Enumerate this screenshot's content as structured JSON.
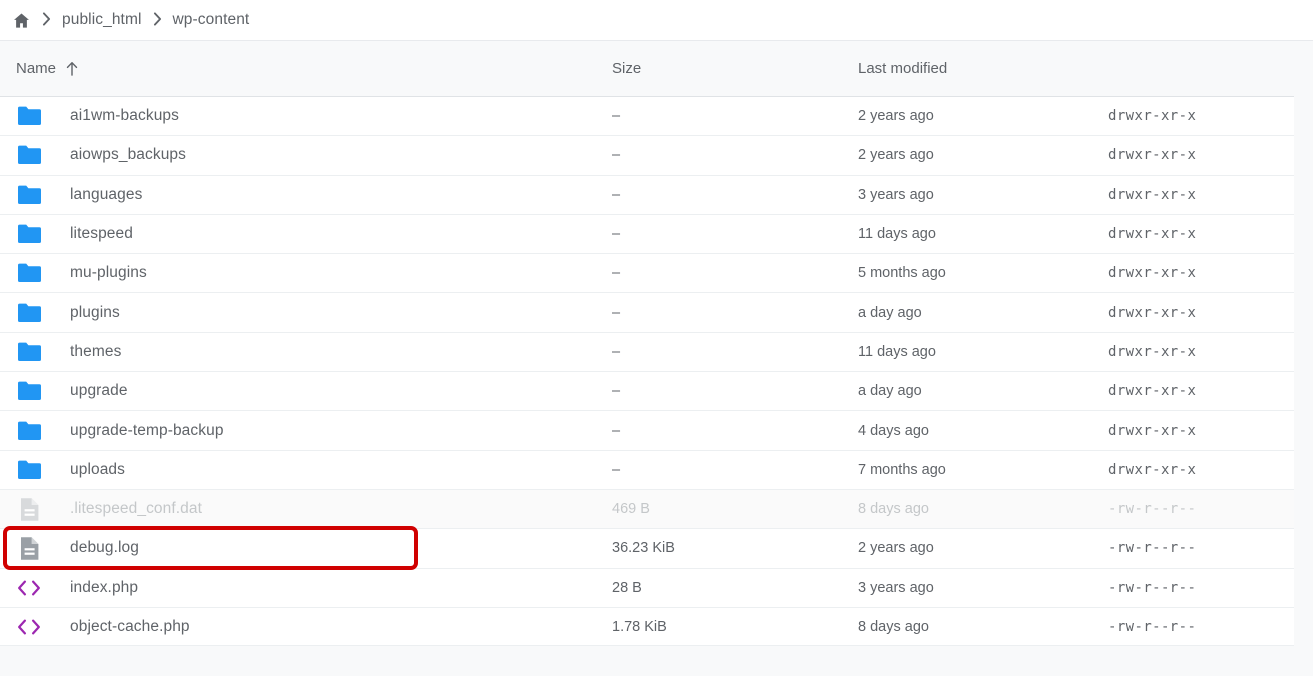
{
  "breadcrumb": {
    "home_icon": "home-icon",
    "separator": "›",
    "items": [
      {
        "label": "public_html"
      },
      {
        "label": "wp-content"
      }
    ]
  },
  "table": {
    "columns": {
      "name": "Name",
      "sort_indicator": "↑",
      "size": "Size",
      "modified": "Last modified",
      "permissions": ""
    },
    "rows": [
      {
        "icon": "folder-icon",
        "name": "ai1wm-backups",
        "size": "–",
        "modified": "2 years ago",
        "permissions": "drwxr-xr-x",
        "dimmed": false,
        "highlighted": false
      },
      {
        "icon": "folder-icon",
        "name": "aiowps_backups",
        "size": "–",
        "modified": "2 years ago",
        "permissions": "drwxr-xr-x",
        "dimmed": false,
        "highlighted": false
      },
      {
        "icon": "folder-icon",
        "name": "languages",
        "size": "–",
        "modified": "3 years ago",
        "permissions": "drwxr-xr-x",
        "dimmed": false,
        "highlighted": false
      },
      {
        "icon": "folder-icon",
        "name": "litespeed",
        "size": "–",
        "modified": "11 days ago",
        "permissions": "drwxr-xr-x",
        "dimmed": false,
        "highlighted": false
      },
      {
        "icon": "folder-icon",
        "name": "mu-plugins",
        "size": "–",
        "modified": "5 months ago",
        "permissions": "drwxr-xr-x",
        "dimmed": false,
        "highlighted": false
      },
      {
        "icon": "folder-icon",
        "name": "plugins",
        "size": "–",
        "modified": "a day ago",
        "permissions": "drwxr-xr-x",
        "dimmed": false,
        "highlighted": false
      },
      {
        "icon": "folder-icon",
        "name": "themes",
        "size": "–",
        "modified": "11 days ago",
        "permissions": "drwxr-xr-x",
        "dimmed": false,
        "highlighted": false
      },
      {
        "icon": "folder-icon",
        "name": "upgrade",
        "size": "–",
        "modified": "a day ago",
        "permissions": "drwxr-xr-x",
        "dimmed": false,
        "highlighted": false
      },
      {
        "icon": "folder-icon",
        "name": "upgrade-temp-backup",
        "size": "–",
        "modified": "4 days ago",
        "permissions": "drwxr-xr-x",
        "dimmed": false,
        "highlighted": false
      },
      {
        "icon": "folder-icon",
        "name": "uploads",
        "size": "–",
        "modified": "7 months ago",
        "permissions": "drwxr-xr-x",
        "dimmed": false,
        "highlighted": false
      },
      {
        "icon": "file-icon",
        "name": ".litespeed_conf.dat",
        "size": "469 B",
        "modified": "8 days ago",
        "permissions": "-rw-r--r--",
        "dimmed": true,
        "highlighted": false
      },
      {
        "icon": "file-icon",
        "name": "debug.log",
        "size": "36.23 KiB",
        "modified": "2 years ago",
        "permissions": "-rw-r--r--",
        "dimmed": false,
        "highlighted": true
      },
      {
        "icon": "code-icon",
        "name": "index.php",
        "size": "28 B",
        "modified": "3 years ago",
        "permissions": "-rw-r--r--",
        "dimmed": false,
        "highlighted": false
      },
      {
        "icon": "code-icon",
        "name": "object-cache.php",
        "size": "1.78 KiB",
        "modified": "8 days ago",
        "permissions": "-rw-r--r--",
        "dimmed": false,
        "highlighted": false
      }
    ]
  },
  "colors": {
    "folder": "#2196f3",
    "file": "#9aa0a6",
    "code": "#9c27b0",
    "annotation": "#d00000",
    "text": "#5f6368",
    "background": "#f8f9fa"
  }
}
